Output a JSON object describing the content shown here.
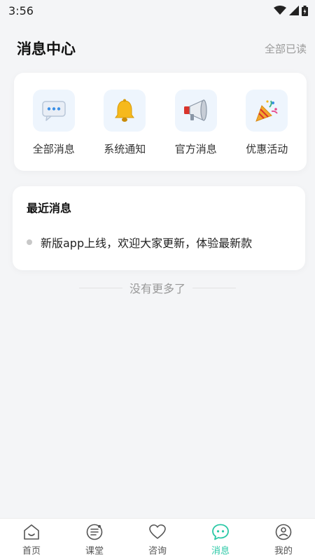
{
  "status_bar": {
    "time": "3:56"
  },
  "header": {
    "title": "消息中心",
    "mark_all_read": "全部已读"
  },
  "categories": [
    {
      "label": "全部消息",
      "icon": "chat-bubble-icon"
    },
    {
      "label": "系统通知",
      "icon": "bell-icon"
    },
    {
      "label": "官方消息",
      "icon": "megaphone-icon"
    },
    {
      "label": "优惠活动",
      "icon": "party-popper-icon"
    }
  ],
  "recent": {
    "title": "最近消息",
    "items": [
      {
        "text": "新版app上线，欢迎大家更新，体验最新款"
      }
    ]
  },
  "footer_note": "没有更多了",
  "tabs": [
    {
      "label": "首页",
      "icon": "home-icon",
      "active": false
    },
    {
      "label": "课堂",
      "icon": "classroom-icon",
      "active": false
    },
    {
      "label": "咨询",
      "icon": "heart-icon",
      "active": false
    },
    {
      "label": "消息",
      "icon": "message-icon",
      "active": true
    },
    {
      "label": "我的",
      "icon": "profile-icon",
      "active": false
    }
  ],
  "colors": {
    "accent": "#2ac8a6",
    "background": "#f4f5f7",
    "icon_tile": "#eef5fd"
  }
}
